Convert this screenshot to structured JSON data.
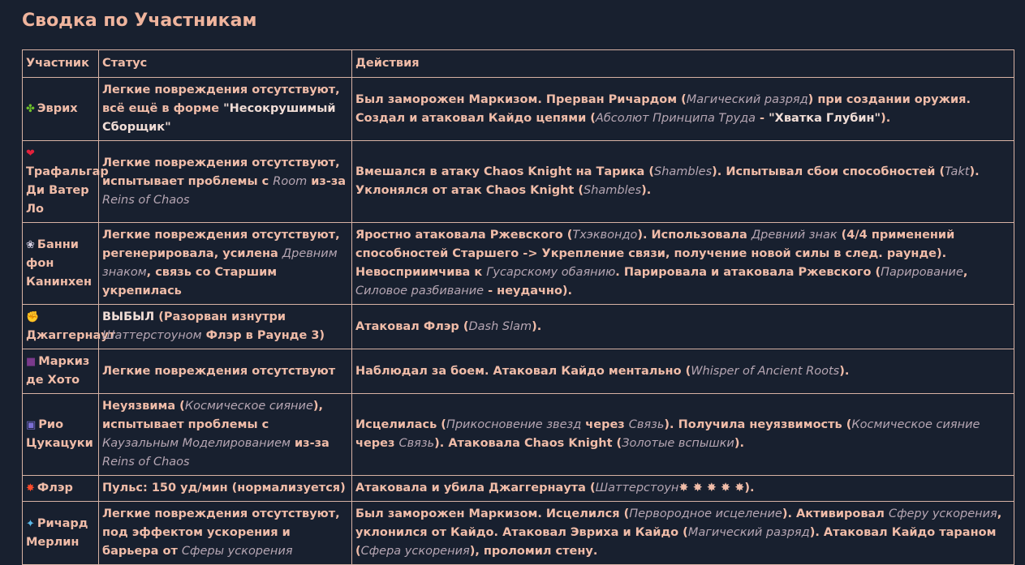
{
  "heading": "Сводка по Участникам",
  "table": {
    "headers": [
      "Участник",
      "Статус",
      "Действия"
    ],
    "rows": [
      {
        "icon": "clover-icon",
        "glyph": "✤",
        "name": "Эврих",
        "status": [
          {
            "t": "Легкие повреждения отсутствуют, всё ещё в форме "
          },
          {
            "t": "\"Несокрушимый Сборщик\"",
            "s": "wh"
          }
        ],
        "actions": [
          {
            "t": "Был заморожен Маркизом. Прерван Ричардом ("
          },
          {
            "t": "Магический разряд",
            "s": "it"
          },
          {
            "t": ") при создании оружия. Создал и атаковал Кайдо цепями ("
          },
          {
            "t": "Абсолют Принципа Труда",
            "s": "it"
          },
          {
            "t": " - "
          },
          {
            "t": "\"Хватка Глубин\"",
            "s": "wh"
          },
          {
            "t": ")."
          }
        ]
      },
      {
        "icon": "heart-icon",
        "glyph": "❤",
        "name": "Трафальгар Ди Ватер Ло",
        "block": true,
        "status": [
          {
            "t": "Легкие повреждения отсутствуют, испытывает проблемы с "
          },
          {
            "t": "Room",
            "s": "it"
          },
          {
            "t": " из-за "
          },
          {
            "t": "Reins of Chaos",
            "s": "it"
          }
        ],
        "actions": [
          {
            "t": "Вмешался в атаку Chaos Knight на Тарика ("
          },
          {
            "t": "Shambles",
            "s": "it"
          },
          {
            "t": "). Испытывал сбои способностей ("
          },
          {
            "t": "Takt",
            "s": "it"
          },
          {
            "t": "). Уклонялся от атак Chaos Knight ("
          },
          {
            "t": "Shambles",
            "s": "it"
          },
          {
            "t": ")."
          }
        ]
      },
      {
        "icon": "rabbit-icon",
        "glyph": "❀",
        "name": "Банни фон Канинхен",
        "status": [
          {
            "t": "Легкие повреждения отсутствуют, регенерировала, усилена "
          },
          {
            "t": "Древним знаком",
            "s": "it"
          },
          {
            "t": ", связь со Старшим укрепилась"
          }
        ],
        "actions": [
          {
            "t": "Яростно атаковала Ржевского ("
          },
          {
            "t": "Тхэквондо",
            "s": "it"
          },
          {
            "t": "). Использовала "
          },
          {
            "t": "Древний знак",
            "s": "it"
          },
          {
            "t": " (4/4 применений способностей Старшего -> Укрепление связи, получение новой силы в след. раунде). Невосприимчива к "
          },
          {
            "t": "Гусарскому обаянию",
            "s": "it"
          },
          {
            "t": ". Парировала и атаковала Ржевского ("
          },
          {
            "t": "Парирование",
            "s": "it"
          },
          {
            "t": ", "
          },
          {
            "t": "Силовое разбивание",
            "s": "it"
          },
          {
            "t": " - неудачно)."
          }
        ]
      },
      {
        "icon": "flexed-arm-icon",
        "glyph": "✊",
        "name": "Джаггернаут",
        "block": true,
        "status": [
          {
            "t": "ВЫБЫЛ",
            "s": "wh"
          },
          {
            "t": " (Разорван изнутри "
          },
          {
            "t": "Шаттерстоуном",
            "s": "it"
          },
          {
            "t": " Флэр в Раунде 3)"
          }
        ],
        "actions": [
          {
            "t": "Атаковал Флэр ("
          },
          {
            "t": "Dash Slam",
            "s": "it"
          },
          {
            "t": ")."
          }
        ]
      },
      {
        "icon": "top-hat-icon",
        "glyph": "■",
        "name": "Маркиз де Хото",
        "status": [
          {
            "t": "Легкие повреждения отсутствуют"
          }
        ],
        "actions": [
          {
            "t": "Наблюдал за боем. Атаковал Кайдо ментально ("
          },
          {
            "t": "Whisper of Ancient Roots",
            "s": "it"
          },
          {
            "t": ")."
          }
        ]
      },
      {
        "icon": "floppy-disk-icon",
        "glyph": "▣",
        "name": "Рио Цукацуки",
        "status": [
          {
            "t": "Неуязвима ("
          },
          {
            "t": "Космическое сияние",
            "s": "it"
          },
          {
            "t": "), испытывает проблемы с "
          },
          {
            "t": "Каузальным Моделированием",
            "s": "it"
          },
          {
            "t": " из-за "
          },
          {
            "t": "Reins of Chaos",
            "s": "it"
          }
        ],
        "actions": [
          {
            "t": "Исцелилась ("
          },
          {
            "t": "Прикосновение звезд",
            "s": "it"
          },
          {
            "t": " через "
          },
          {
            "t": "Связь",
            "s": "it"
          },
          {
            "t": "). Получила неуязвимость ("
          },
          {
            "t": "Космическое сияние",
            "s": "it"
          },
          {
            "t": " через "
          },
          {
            "t": "Связь",
            "s": "it"
          },
          {
            "t": "). Атаковала Chaos Knight ("
          },
          {
            "t": "Золотые вспышки",
            "s": "it"
          },
          {
            "t": ")."
          }
        ]
      },
      {
        "icon": "collision-icon",
        "glyph": "✸",
        "name": "Флэр",
        "status": [
          {
            "t": "Пульс: 150 уд/мин (нормализуется)"
          }
        ],
        "actions": [
          {
            "t": "Атаковала и убила Джаггернаута ("
          },
          {
            "t": "Шаттерстоун",
            "s": "it"
          },
          {
            "t": "✸ ✸ ✸ ✸ ✸",
            "s": "bursts"
          },
          {
            "t": ")."
          }
        ]
      },
      {
        "icon": "mage-icon",
        "glyph": "✦",
        "name": "Ричард Мерлин",
        "status": [
          {
            "t": "Легкие повреждения отсутствуют, под эффектом ускорения и барьера от "
          },
          {
            "t": "Сферы ускорения",
            "s": "it"
          }
        ],
        "actions": [
          {
            "t": "Был заморожен Маркизом. Исцелился ("
          },
          {
            "t": "Первородное исцеление",
            "s": "it"
          },
          {
            "t": "). Активировал "
          },
          {
            "t": "Сферу ускорения",
            "s": "it"
          },
          {
            "t": ", уклонился от Кайдо. Атаковал Эвриха и Кайдо ("
          },
          {
            "t": "Магический разряд",
            "s": "it"
          },
          {
            "t": "). Атаковал Кайдо тараном ("
          },
          {
            "t": "Сфера ускорения",
            "s": "it"
          },
          {
            "t": "), проломил стену."
          }
        ]
      }
    ]
  },
  "colors": {
    "background": "#18202f",
    "text": "#f0bca8",
    "border": "#d7b2a4",
    "italic": "#b6a6b3"
  }
}
